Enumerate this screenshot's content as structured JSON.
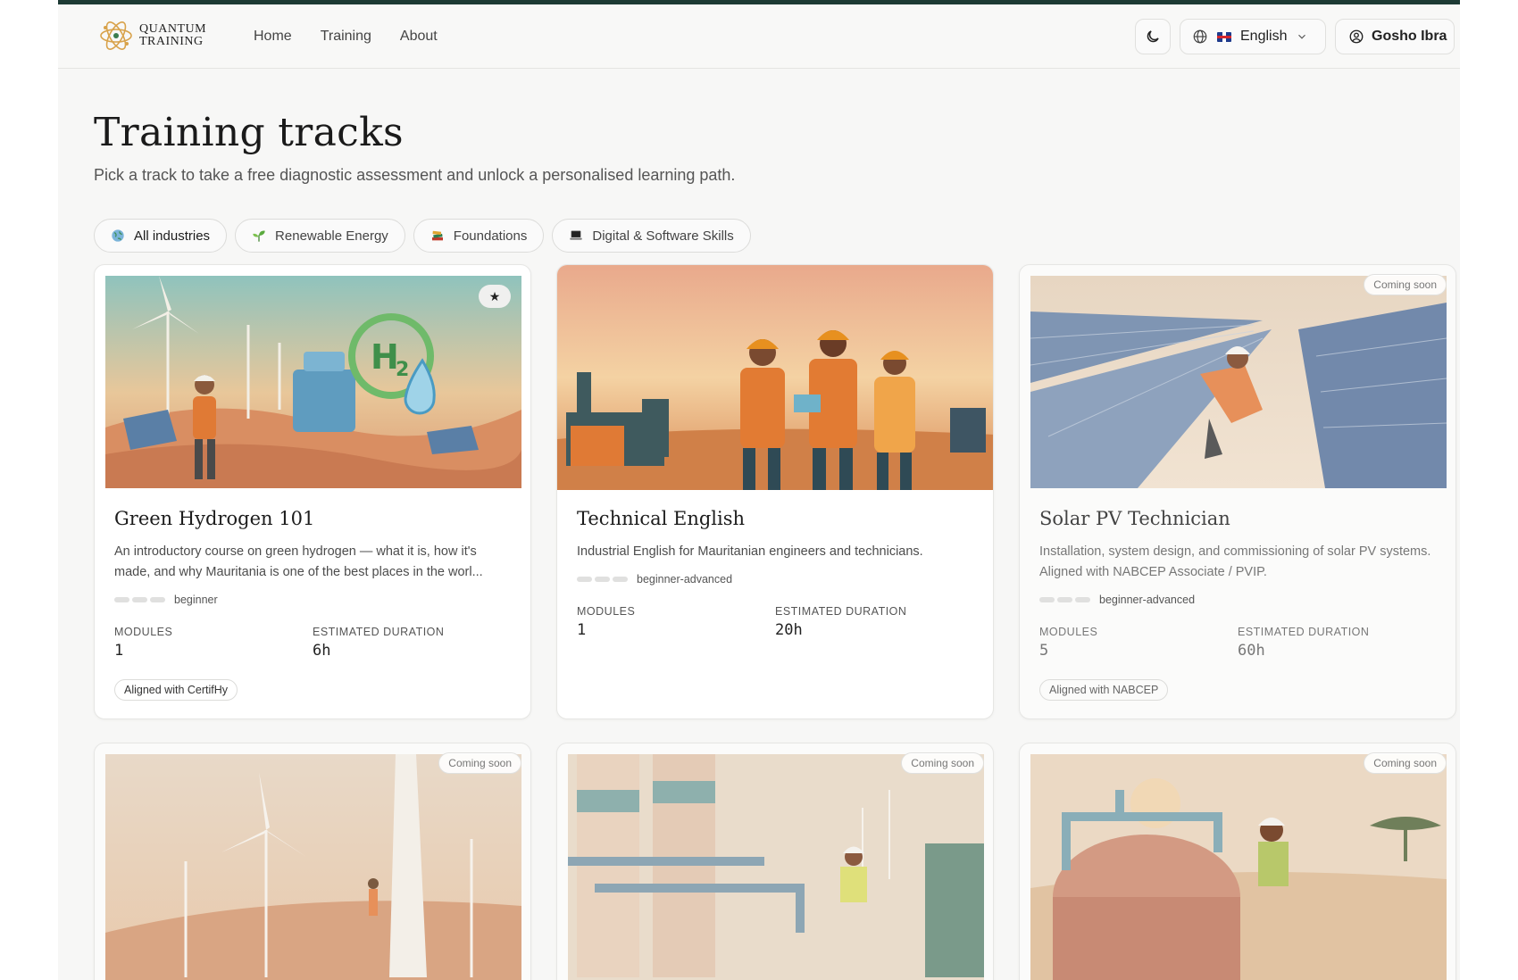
{
  "brand": {
    "line1": "QUANTUM",
    "line2": "TRAINING"
  },
  "nav": [
    {
      "label": "Home"
    },
    {
      "label": "Training"
    },
    {
      "label": "About"
    }
  ],
  "header": {
    "theme_icon": "moon-icon",
    "language": {
      "icon": "globe-icon",
      "flag": "uk-flag",
      "label": "English"
    },
    "user": {
      "icon": "user-circle-icon",
      "label": "Gosho Ibra"
    }
  },
  "page": {
    "title": "Training tracks",
    "subtitle": "Pick a track to take a free diagnostic assessment and unlock a personalised learning path."
  },
  "filters": [
    {
      "label": "All industries",
      "icon": "globe-icon",
      "active": true
    },
    {
      "label": "Renewable Energy",
      "icon": "seedling-icon",
      "active": false
    },
    {
      "label": "Foundations",
      "icon": "books-icon",
      "active": false
    },
    {
      "label": "Digital & Software Skills",
      "icon": "laptop-icon",
      "active": false
    }
  ],
  "cards": [
    {
      "title": "Green Hydrogen 101",
      "description": "An introductory course on green hydrogen — what it is, how it's made, and why Mauritania is one of the best places in the worl...",
      "level": "beginner",
      "modules_label": "MODULES",
      "modules": "1",
      "duration_label": "ESTIMATED DURATION",
      "duration": "6h",
      "tag": "Aligned with CertifHy",
      "featured_icon": "★"
    },
    {
      "title": "Technical English",
      "description": "Industrial English for Mauritanian engineers and technicians.",
      "level": "beginner-advanced",
      "modules_label": "MODULES",
      "modules": "1",
      "duration_label": "ESTIMATED DURATION",
      "duration": "20h"
    },
    {
      "title": "Solar PV Technician",
      "description": "Installation, system design, and commissioning of solar PV systems. Aligned with NABCEP Associate / PVIP.",
      "level": "beginner-advanced",
      "modules_label": "MODULES",
      "modules": "5",
      "duration_label": "ESTIMATED DURATION",
      "duration": "60h",
      "tag": "Aligned with NABCEP",
      "badge": "Coming soon"
    },
    {
      "badge": "Coming soon"
    },
    {
      "badge": "Coming soon"
    },
    {
      "badge": "Coming soon"
    }
  ]
}
